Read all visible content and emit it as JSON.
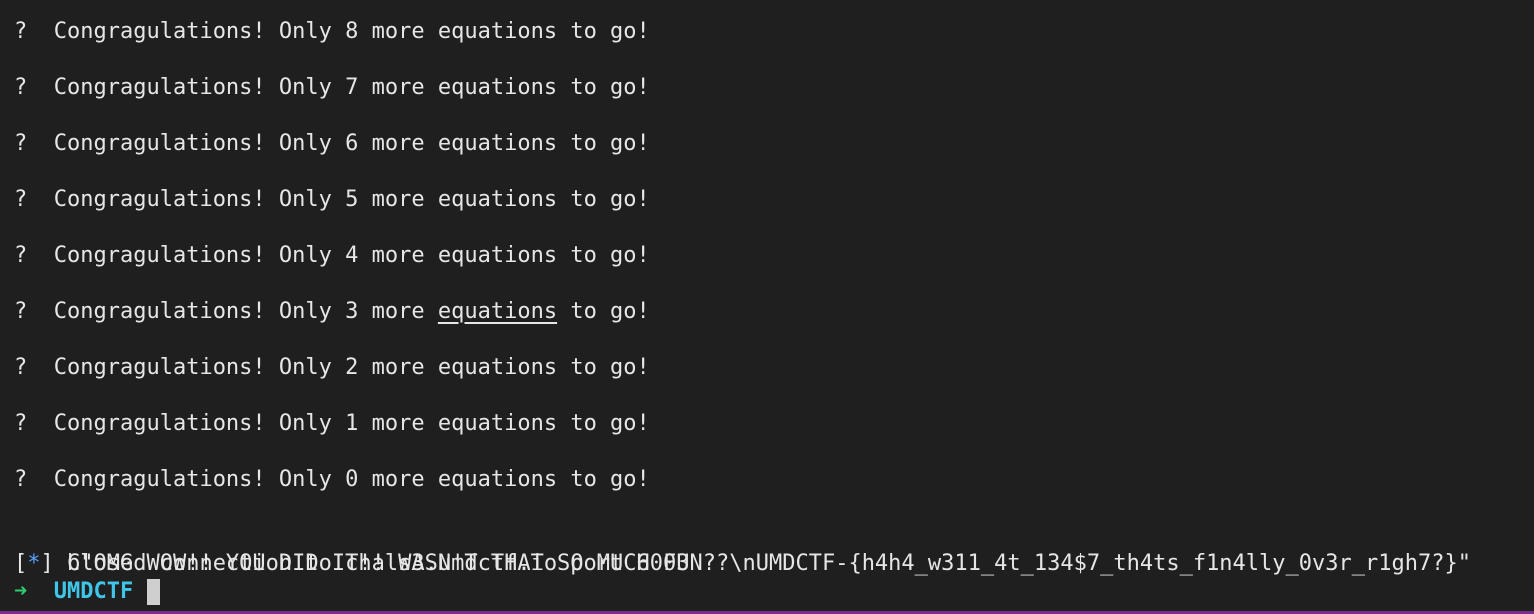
{
  "terminal": {
    "lines": [
      {
        "prefix": "?",
        "text_before": "Congragulations! Only 8 more ",
        "underlined": "equations",
        "text_after": " to go!",
        "underline": false
      },
      {
        "prefix": "?",
        "text_before": "Congragulations! Only 7 more ",
        "underlined": "equations",
        "text_after": " to go!",
        "underline": false
      },
      {
        "prefix": "?",
        "text_before": "Congragulations! Only 6 more ",
        "underlined": "equations",
        "text_after": " to go!",
        "underline": false
      },
      {
        "prefix": "?",
        "text_before": "Congragulations! Only 5 more ",
        "underlined": "equations",
        "text_after": " to go!",
        "underline": false
      },
      {
        "prefix": "?",
        "text_before": "Congragulations! Only 4 more ",
        "underlined": "equations",
        "text_after": " to go!",
        "underline": false
      },
      {
        "prefix": "?",
        "text_before": "Congragulations! Only 3 more ",
        "underlined": "equations",
        "text_after": " to go!",
        "underline": true
      },
      {
        "prefix": "?",
        "text_before": "Congragulations! Only 2 more ",
        "underlined": "equations",
        "text_after": " to go!",
        "underline": false
      },
      {
        "prefix": "?",
        "text_before": "Congragulations! Only 1 more ",
        "underlined": "equations",
        "text_after": " to go!",
        "underline": false
      },
      {
        "prefix": "?",
        "text_before": "Congragulations! Only 0 more ",
        "underlined": "equations",
        "text_after": " to go!",
        "underline": false
      }
    ],
    "flag_line": "b\"OMG WOW!! YOU DID IT!! WASN'T THAT SO MUCH FUN??\\nUMDCTF-{h4h4_w311_4t_134$7_th4ts_f1n4lly_0v3r_r1gh7?}\"",
    "closed": {
      "open_bracket": "[",
      "star": "*",
      "close_bracket": "]",
      "text": " Closed connection to chals3.umdctf.io port 6003"
    },
    "prompt": {
      "arrow": "➜",
      "directory": "UMDCTF"
    },
    "colors": {
      "background": "#1f1f1f",
      "text": "#e6e6e6",
      "arrow": "#2ecc71",
      "directory": "#3ec5e8",
      "star": "#5aa0ff",
      "bottom_border": "#7b2e8e"
    },
    "cursor_icon": "block-cursor"
  }
}
